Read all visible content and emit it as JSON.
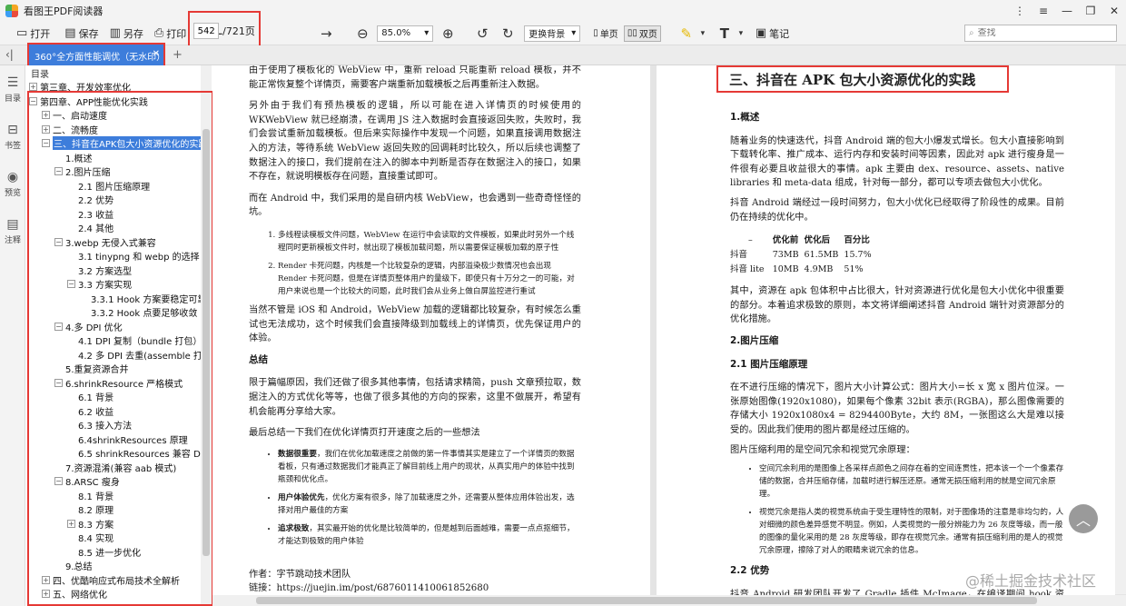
{
  "app": {
    "title": "看图王PDF阅读器"
  },
  "window": {
    "controls": [
      "⋮",
      "≡",
      "—",
      "❐",
      "✕"
    ]
  },
  "toolbar": {
    "open": "打开",
    "save": "保存",
    "save_as": "另存",
    "print": "打印",
    "page_current": "542",
    "page_total": "/721页",
    "zoom": "85.0%",
    "bg": "更换背景",
    "single": "单页",
    "double": "双页",
    "note": "笔记",
    "search_placeholder": "查找"
  },
  "tab": {
    "title": "360°全方面性能调优（无水印）",
    "close": "✕",
    "add": "+"
  },
  "side": {
    "toc": "目录",
    "bookmark": "书签",
    "preview": "预览",
    "annot": "注释"
  },
  "toc": {
    "header": "目录",
    "items": [
      {
        "lvl": 0,
        "ex": "+",
        "t": "第三章、开发效率优化"
      },
      {
        "lvl": 0,
        "ex": "−",
        "t": "第四章、APP性能优化实践"
      },
      {
        "lvl": 1,
        "ex": "+",
        "t": "一、启动速度"
      },
      {
        "lvl": 1,
        "ex": "+",
        "t": "二、流畅度"
      },
      {
        "lvl": 1,
        "ex": "−",
        "t": "三、抖音在APK包大小资源优化的实践",
        "sel": true
      },
      {
        "lvl": 2,
        "ex": "",
        "t": "1.概述"
      },
      {
        "lvl": 2,
        "ex": "−",
        "t": "2.图片压缩"
      },
      {
        "lvl": 3,
        "ex": "",
        "t": "2.1 图片压缩原理"
      },
      {
        "lvl": 3,
        "ex": "",
        "t": "2.2 优势"
      },
      {
        "lvl": 3,
        "ex": "",
        "t": "2.3 收益"
      },
      {
        "lvl": 3,
        "ex": "",
        "t": "2.4 其他"
      },
      {
        "lvl": 2,
        "ex": "−",
        "t": "3.webp 无侵入式兼容"
      },
      {
        "lvl": 3,
        "ex": "",
        "t": "3.1 tinypng 和 webp 的选择"
      },
      {
        "lvl": 3,
        "ex": "",
        "t": "3.2 方案选型"
      },
      {
        "lvl": 3,
        "ex": "−",
        "t": "3.3 方案实现"
      },
      {
        "lvl": 4,
        "ex": "",
        "t": "3.3.1 Hook 方案要稳定可靠"
      },
      {
        "lvl": 4,
        "ex": "",
        "t": "3.3.2 Hook 点要足够收敛"
      },
      {
        "lvl": 2,
        "ex": "−",
        "t": "4.多 DPI 优化"
      },
      {
        "lvl": 3,
        "ex": "",
        "t": "4.1 DPI 复制（bundle 打包）"
      },
      {
        "lvl": 3,
        "ex": "",
        "t": "4.2 多 DPI 去重(assemble 打包)"
      },
      {
        "lvl": 2,
        "ex": "",
        "t": "5.重复资源合并"
      },
      {
        "lvl": 2,
        "ex": "−",
        "t": "6.shrinkResource 严格模式"
      },
      {
        "lvl": 3,
        "ex": "",
        "t": "6.1 背景"
      },
      {
        "lvl": 3,
        "ex": "",
        "t": "6.2 收益"
      },
      {
        "lvl": 3,
        "ex": "",
        "t": "6.3 接入方法"
      },
      {
        "lvl": 3,
        "ex": "",
        "t": "6.4shrinkResources 原理"
      },
      {
        "lvl": 3,
        "ex": "",
        "t": "6.5 shrinkResources 兼容 Dynamic"
      },
      {
        "lvl": 2,
        "ex": "",
        "t": "7.资源混淆(兼容 aab 模式)"
      },
      {
        "lvl": 2,
        "ex": "−",
        "t": "8.ARSC 瘦身"
      },
      {
        "lvl": 3,
        "ex": "",
        "t": "8.1 背景"
      },
      {
        "lvl": 3,
        "ex": "",
        "t": "8.2 原理"
      },
      {
        "lvl": 3,
        "ex": "+",
        "t": "8.3 方案"
      },
      {
        "lvl": 3,
        "ex": "",
        "t": "8.4 实现"
      },
      {
        "lvl": 3,
        "ex": "",
        "t": "8.5 进一步优化"
      },
      {
        "lvl": 2,
        "ex": "",
        "t": "9.总结"
      },
      {
        "lvl": 1,
        "ex": "+",
        "t": "四、优酷响应式布局技术全解析"
      },
      {
        "lvl": 1,
        "ex": "+",
        "t": "五、网络优化"
      }
    ]
  },
  "left_page": {
    "p1": "由于使用了模板化的 WebView 中，重新 reload 只能重新 reload 模板，并不能正常恢复整个详情页，需要客户端重新加载模板之后再重新注入数据。",
    "p2": "另外由于我们有预热模板的逻辑，所以可能在进入详情页的时候使用的 WKWebView 就已经崩溃，在调用 JS 注入数据时会直接返回失败，失败时，我们会尝试重新加载模板。但后来实际操作中发现一个问题，如果直接调用数据注入的方法，等待系统 WebView 返回失败的回调耗时比较久，所以后续也调整了数据注入的接口，我们提前在注入的脚本中判断是否存在数据注入的接口，如果不存在，就说明模板存在问题，直接重试即可。",
    "p3": "而在 Android 中，我们采用的是自研内核 WebView，也会遇到一些奇奇怪怪的坑。",
    "li1": "多线程读模板文件问题，WebView 在运行中会读取的文件模板，如果此时另外一个线程同时更新模板文件时，就出现了模板加载问题，所以需要保证模板加载的原子性",
    "li2": "Render 卡死问题，内核是一个比较复杂的逻辑，内部溢染极少数情况也会出现 Render 卡死问题，但是在详情页整体用户的量级下，即使只有十万分之一的可能，对用户来说也是一个比较大的问题，此时我们会从业务上做白屏监控进行重试",
    "p4": "当然不管是 iOS 和 Android，WebView 加载的逻辑都比较复杂，有时候怎么重试也无法成功，这个时候我们会直接降级到加载线上的详情页，优先保证用户的体验。",
    "h_summary": "总结",
    "p5": "限于篇幅原因，我们还做了很多其他事情，包括请求精简，push 文章预拉取，数据注入的方式优化等等，也做了很多其他的方向的探索，这里不做展开，希望有机会能再分享给大家。",
    "p6": "最后总结一下我们在优化详情页打开速度之后的一些想法",
    "b1_head": "数据很重要",
    "b1": "，我们在优化加载速度之前做的第一件事情其实是建立了一个详情页的数据看板，只有通过数据我们才能真正了解目前线上用户的现状，从真实用户的体验中找到瓶颈和优化点。",
    "b2_head": "用户体验优先",
    "b2": "，优化方案有很多，除了加载速度之外，还需要从整体应用体验出发，选择对用户最佳的方案",
    "b3_head": "追求极致",
    "b3": "，其实最开始的优化是比较简单的，但是越到后面越难，需要一点点抠细节，才能达到极致的用户体验",
    "author": "作者：字节跳动技术团队",
    "link": "链接：https://juejin.im/post/6876011410061852680"
  },
  "right_page": {
    "title": "三、抖音在 APK 包大小资源优化的实践",
    "h1": "1.概述",
    "p1": "随着业务的快速迭代，抖音 Android 端的包大小爆发式增长。包大小直接影响到下载转化率、推广成本、运行内存和安装时间等因素，因此对 apk 进行瘦身是一件很有必要且收益很大的事情。apk 主要由 dex、resource、assets、native libraries 和 meta-data 组成，针对每一部分，都可以专项去做包大小优化。",
    "p2": "抖音 Android 端经过一段时间努力，包大小优化已经取得了阶段性的成果。目前仍在持续的优化中。",
    "tbl_head": [
      "–",
      "优化前",
      "优化后",
      "百分比"
    ],
    "tbl_r1": [
      "抖音",
      "73MB",
      "61.5MB",
      "15.7%"
    ],
    "tbl_r2": [
      "抖音 lite",
      "10MB",
      "4.9MB",
      "51%"
    ],
    "p3": "其中，资源在 apk 包体积中占比很大，针对资源进行优化是包大小优化中很重要的部分。本着追求极致的原则，本文将详细阐述抖音 Android 端针对资源部分的优化措施。",
    "h2": "2.图片压缩",
    "h21": "2.1 图片压缩原理",
    "p4": "在不进行压缩的情况下，图片大小计算公式：图片大小=长 x 宽 x 图片位深。一张原始图像(1920x1080)，如果每个像素 32bit 表示(RGBA)，那么图像需要的存储大小 1920x1080x4 = 8294400Byte，大约 8M，一张图这么大是难以接受的。因此我们使用的图片都是经过压缩的。",
    "p5": "图片压缩利用的是空间冗余和视觉冗余原理：",
    "li1": "空间冗余利用的是图像上各采样点颜色之间存在着的空间连贯性，把本该一个一个像素存储的数据，合并压缩存储，加载时进行解压还原。通常无损压缩利用的就是空间冗余原理。",
    "li2": "视觉冗余是指人类的视觉系统由于受生理特性的限制，对于图像场的注意是非均匀的，人对细微的颜色差异感觉不明显。例如，人类视觉的一般分辨能力为 26 灰度等级，而一般的图像的量化采用的是 28 灰度等级，即存在视觉冗余。通常有损压缩利用的是人的视觉冗余原理，擦除了对人的眼睛来说冗余的信息。",
    "h22": "2.2 优势",
    "p6": "抖音 Android 研发团队开发了 Gradle 插件 McImage，在编译期间 hook 资源，"
  },
  "watermark": "@稀土掘金技术社区",
  "colors": {
    "accent": "#3d7ddb",
    "highlight": "#e53935"
  }
}
